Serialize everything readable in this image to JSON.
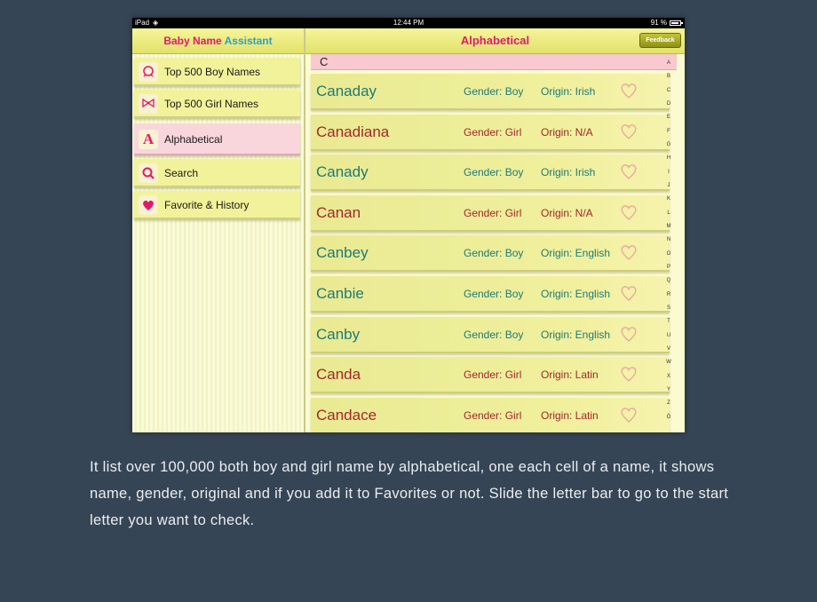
{
  "status_bar": {
    "device": "iPad",
    "time": "12:44 PM",
    "battery": "91 %"
  },
  "sidebar": {
    "title_part1": "Baby Name",
    "title_part2": "Assistant",
    "items": [
      {
        "label": "Top 500 Boy Names",
        "icon": "boy-face-icon"
      },
      {
        "label": "Top 500 Girl Names",
        "icon": "girl-bow-icon"
      },
      {
        "label": "Alphabetical",
        "icon": "letter-a-icon",
        "active": true
      },
      {
        "label": "Search",
        "icon": "magnifier-icon"
      },
      {
        "label": "Favorite & History",
        "icon": "heart-icon"
      }
    ]
  },
  "main": {
    "title": "Alphabetical",
    "feedback_label": "Feedback",
    "section_letter": "C",
    "rows": [
      {
        "name": "Canaday",
        "gender": "Gender: Boy",
        "origin": "Origin: Irish",
        "type": "boy"
      },
      {
        "name": "Canadiana",
        "gender": "Gender: Girl",
        "origin": "Origin: N/A",
        "type": "girl"
      },
      {
        "name": "Canady",
        "gender": "Gender: Boy",
        "origin": "Origin: Irish",
        "type": "boy"
      },
      {
        "name": "Canan",
        "gender": "Gender: Girl",
        "origin": "Origin: N/A",
        "type": "girl"
      },
      {
        "name": "Canbey",
        "gender": "Gender: Boy",
        "origin": "Origin: English",
        "type": "boy"
      },
      {
        "name": "Canbie",
        "gender": "Gender: Boy",
        "origin": "Origin: English",
        "type": "boy"
      },
      {
        "name": "Canby",
        "gender": "Gender: Boy",
        "origin": "Origin: English",
        "type": "boy"
      },
      {
        "name": "Canda",
        "gender": "Gender: Girl",
        "origin": "Origin: Latin",
        "type": "girl"
      },
      {
        "name": "Candace",
        "gender": "Gender: Girl",
        "origin": "Origin: Latin",
        "type": "girl"
      }
    ],
    "letters": [
      "A",
      "B",
      "C",
      "D",
      "E",
      "F",
      "G",
      "H",
      "I",
      "J",
      "K",
      "L",
      "M",
      "N",
      "O",
      "P",
      "Q",
      "R",
      "S",
      "T",
      "U",
      "V",
      "W",
      "X",
      "Y",
      "Z",
      "Ö"
    ]
  },
  "caption": "It list over 100,000 both boy and girl name by alphabetical, one each cell of a name, it shows name, gender, original and if you add it to Favorites or not. Slide the letter bar to go to the start letter you want to check.",
  "colors": {
    "background": "#364555",
    "accent_pink": "#e4186e",
    "boy_text": "#1f7a76",
    "girl_text": "#a3282a"
  }
}
